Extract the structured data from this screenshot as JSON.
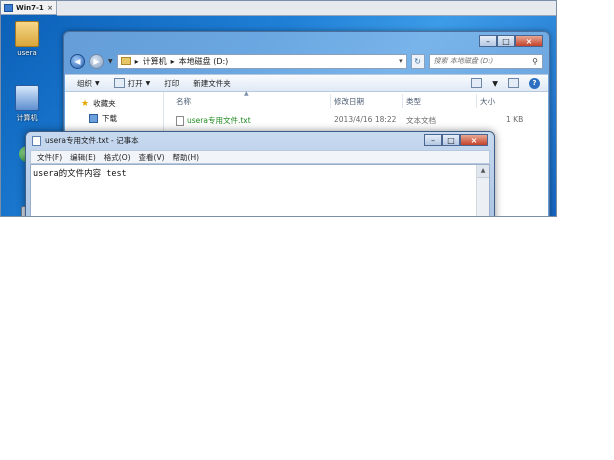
{
  "vm_tab": {
    "label": "Win7-1",
    "close": "×"
  },
  "desktop": {
    "icons": [
      {
        "label": "usera"
      },
      {
        "label": "计算机"
      }
    ]
  },
  "explorer": {
    "breadcrumb": [
      "计算机",
      "本地磁盘 (D:)"
    ],
    "search_placeholder": "搜索 本地磁盘 (D:)",
    "toolbar": {
      "organize": "组织",
      "open": "打开",
      "print": "打印",
      "new_folder": "新建文件夹"
    },
    "sidebar": [
      {
        "label": "收藏夹"
      },
      {
        "label": "下载"
      }
    ],
    "columns": {
      "name": "名称",
      "date": "修改日期",
      "type": "类型",
      "size": "大小"
    },
    "files": [
      {
        "name": "usera专用文件.txt",
        "date": "2013/4/16 18:22",
        "type": "文本文档",
        "size": "1 KB"
      }
    ]
  },
  "notepad": {
    "title": "usera专用文件.txt - 记事本",
    "menu": [
      "文件(F)",
      "编辑(E)",
      "格式(O)",
      "查看(V)",
      "帮助(H)"
    ],
    "content": "usera的文件内容 test"
  },
  "colors": {
    "desktop": "#1f7fd6",
    "file_name": "#1e8a1e",
    "close_button": "#c4412a"
  }
}
